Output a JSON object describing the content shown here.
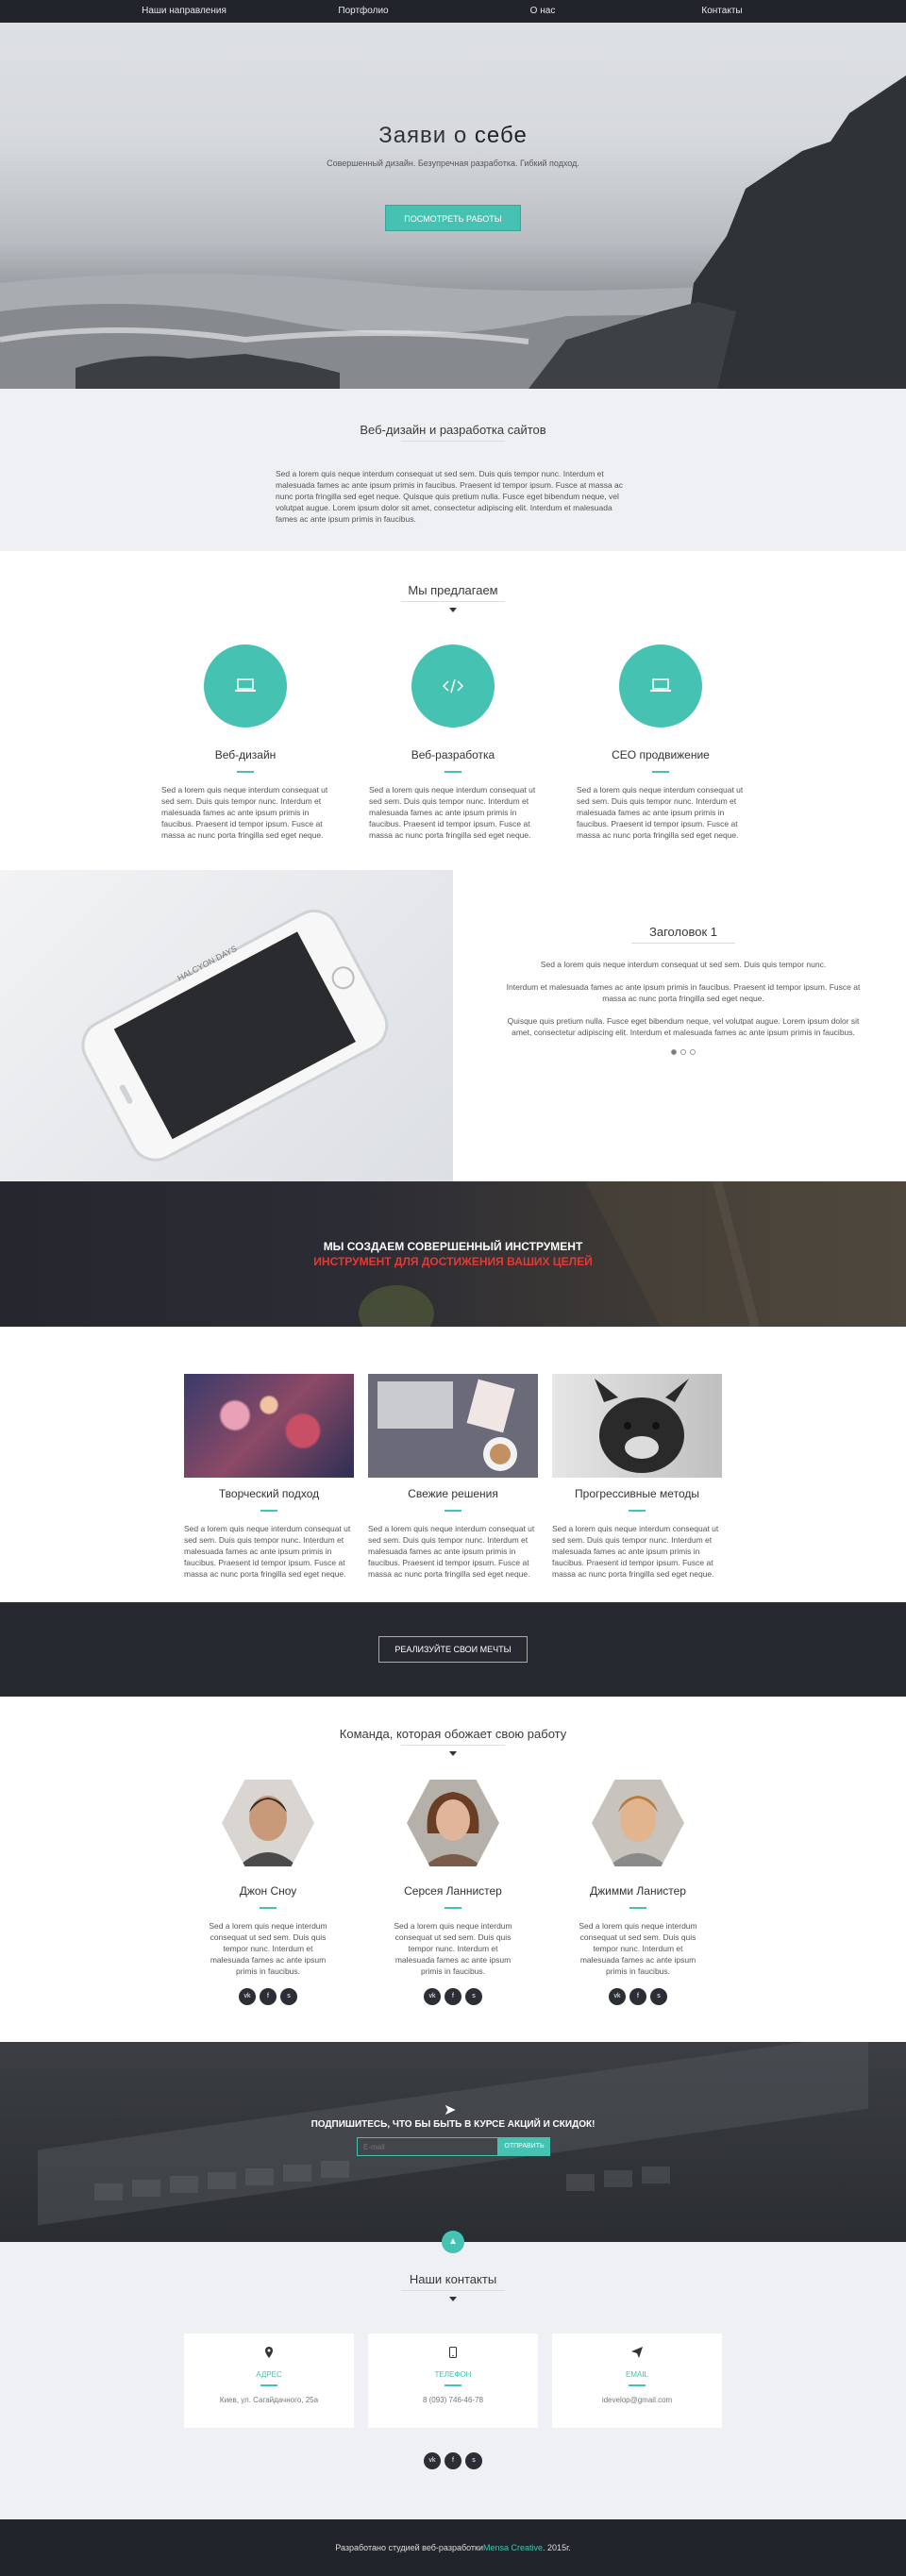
{
  "nav": {
    "items": [
      "Наши направления",
      "Портфолио",
      "О нас",
      "Контакты"
    ]
  },
  "hero": {
    "title_part1": "Заяви о ",
    "title_part2": "себе",
    "subtitle": "Совершенный дизайн. Безупречная разработка. Гибкий подход.",
    "button": "ПОСМОТРЕТЬ РАБОТЫ"
  },
  "about": {
    "title": "Веб-дизайн и разработка сайтов",
    "text": "Sed a lorem quis neque interdum consequat ut sed sem. Duis quis tempor nunc. Interdum et malesuada fames ac ante ipsum primis in faucibus. Praesent id tempor ipsum. Fusce at massa ac nunc porta fringilla sed eget neque. Quisque quis pretium nulla. Fusce eget bibendum neque, vel volutpat augue. Lorem ipsum dolor sit amet, consectetur adipiscing elit. Interdum et malesuada fames ac ante ipsum primis in faucibus."
  },
  "services": {
    "title": "Мы предлагаем",
    "items": [
      {
        "icon": "laptop-icon",
        "title": "Веб-дизайн",
        "text": "Sed a lorem quis neque interdum consequat ut sed sem. Duis quis tempor nunc. Interdum et malesuada fames ac ante ipsum primis in faucibus. Praesent id tempor ipsum. Fusce at massa ac nunc porta fringilla sed eget neque."
      },
      {
        "icon": "code-icon",
        "title": "Веб-разработка",
        "text": "Sed a lorem quis neque interdum consequat ut sed sem. Duis quis tempor nunc. Interdum et malesuada fames ac ante ipsum primis in faucibus. Praesent id tempor ipsum. Fusce at massa ac nunc porta fringilla sed eget neque."
      },
      {
        "icon": "laptop-icon",
        "title": "СЕО продвижение",
        "text": "Sed a lorem quis neque interdum consequat ut sed sem. Duis quis tempor nunc. Interdum et malesuada fames ac ante ipsum primis in faucibus. Praesent id tempor ipsum. Fusce at massa ac nunc porta fringilla sed eget neque."
      }
    ]
  },
  "phone_section": {
    "title": "Заголовок 1",
    "p1": "Sed a lorem quis neque interdum consequat ut sed sem. Duis quis tempor nunc.",
    "p2": "Interdum et malesuada fames ac ante ipsum primis in faucibus. Praesent id tempor ipsum. Fusce at massa ac nunc porta fringilla sed eget neque.",
    "p3": "Quisque quis pretium nulla. Fusce eget bibendum neque, vel volutpat augue. Lorem ipsum dolor sit amet, consectetur adipiscing elit. Interdum et malesuada fames ac ante ipsum primis in faucibus.",
    "screen_text": "HALCYON DAYS"
  },
  "banner": {
    "line1": "МЫ СОЗДАЕМ СОВЕРШЕННЫЙ ИНСТРУМЕНТ",
    "line2": "ИНСТРУМЕНТ ДЛЯ ДОСТИЖЕНИЯ ВАШИХ ЦЕЛЕЙ"
  },
  "features": {
    "items": [
      {
        "title": "Творческий подход",
        "text": "Sed a lorem quis neque interdum consequat ut sed sem. Duis quis tempor nunc. Interdum et malesuada fames ac ante ipsum primis in faucibus. Praesent id tempor ipsum. Fusce at massa ac nunc porta fringilla sed eget neque."
      },
      {
        "title": "Свежие решения",
        "text": "Sed a lorem quis neque interdum consequat ut sed sem. Duis quis tempor nunc. Interdum et malesuada fames ac ante ipsum primis in faucibus. Praesent id tempor ipsum. Fusce at massa ac nunc porta fringilla sed eget neque."
      },
      {
        "title": "Прогрессивные методы",
        "text": "Sed a lorem quis neque interdum consequat ut sed sem. Duis quis tempor nunc. Interdum et malesuada fames ac ante ipsum primis in faucibus. Praesent id tempor ipsum. Fusce at massa ac nunc porta fringilla sed eget neque."
      }
    ]
  },
  "cta": {
    "button": "РЕАЛИЗУЙТЕ СВОИ МЕЧТЫ"
  },
  "team": {
    "title": "Команда, которая обожает свою работу",
    "members": [
      {
        "name": "Джон Сноу",
        "text": "Sed a lorem quis neque interdum consequat ut sed sem. Duis quis tempor nunc. Interdum et malesuada fames ac ante ipsum primis in faucibus."
      },
      {
        "name": "Серсея Ланнистер",
        "text": "Sed a lorem quis neque interdum consequat ut sed sem. Duis quis tempor nunc. Interdum et malesuada fames ac ante ipsum primis in faucibus."
      },
      {
        "name": "Джимми Ланистер",
        "text": "Sed a lorem quis neque interdum consequat ut sed sem. Duis quis tempor nunc. Interdum et malesuada fames ac ante ipsum primis in faucibus."
      }
    ],
    "social": [
      "vk",
      "f",
      "s"
    ]
  },
  "subscribe": {
    "title": "ПОДПИШИТЕСЬ, ЧТО БЫ БЫТЬ В КУРСЕ АКЦИЙ И СКИДОК!",
    "placeholder": "E-mail",
    "button": "ОТПРАВИТЬ"
  },
  "contacts": {
    "title": "Наши контакты",
    "items": [
      {
        "label": "АДРЕС",
        "value": "Киев, ул. Сагайдачного, 25а"
      },
      {
        "label": "ТЕЛЕФОН",
        "value": "8 (093) 746-46-78"
      },
      {
        "label": "EMAIL",
        "value": "idevelop@gmail.com"
      }
    ]
  },
  "footer": {
    "text_pre": "Разработано студией веб-разработки ",
    "brand": "Mensa Creative",
    "text_post": ". 2015г."
  },
  "colors": {
    "accent": "#45c2b1",
    "dark": "#22242b",
    "light_bg": "#eef0f3",
    "highlight": "#e53935"
  }
}
